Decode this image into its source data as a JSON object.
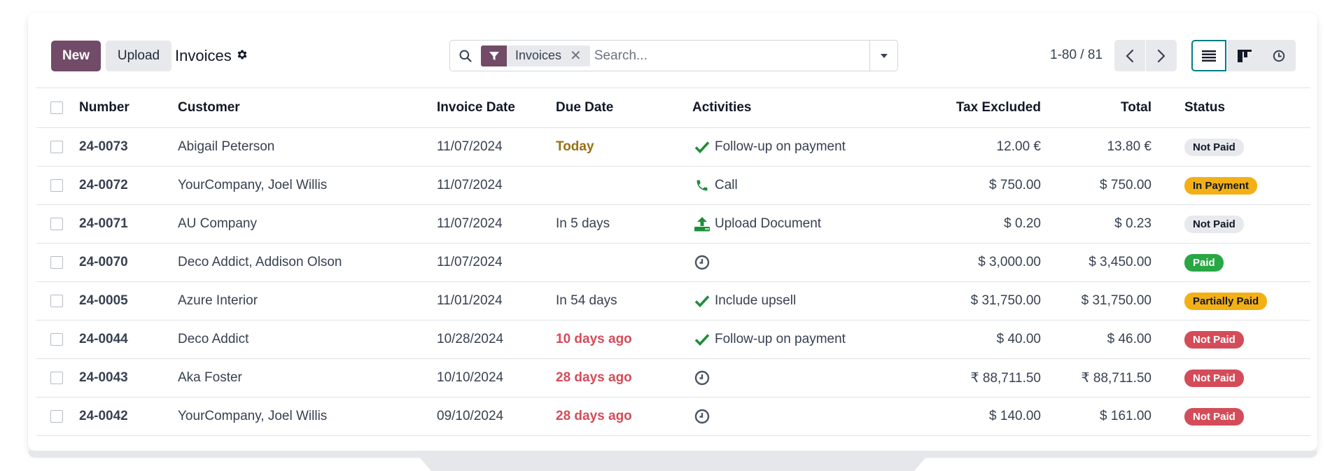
{
  "toolbar": {
    "new_label": "New",
    "upload_label": "Upload",
    "title": "Invoices"
  },
  "search": {
    "facet_label": "Invoices",
    "placeholder": "Search..."
  },
  "pager": {
    "value": "1-80 / 81"
  },
  "table": {
    "headers": {
      "number": "Number",
      "customer": "Customer",
      "invoice_date": "Invoice Date",
      "due_date": "Due Date",
      "activities": "Activities",
      "tax_excluded": "Tax Excluded",
      "total": "Total",
      "status": "Status"
    },
    "rows": [
      {
        "number": "24-0073",
        "customer": "Abigail Peterson",
        "invoice_date": "11/07/2024",
        "due_date": "Today",
        "activity_icon": "check-icon",
        "activity": "Follow-up on payment",
        "tax_excluded": "12.00 €",
        "total": "13.80 €",
        "status": "Not Paid"
      },
      {
        "number": "24-0072",
        "customer": "YourCompany, Joel Willis",
        "invoice_date": "11/07/2024",
        "due_date": "",
        "activity_icon": "phone-icon",
        "activity": "Call",
        "tax_excluded": "$ 750.00",
        "total": "$ 750.00",
        "status": "In Payment"
      },
      {
        "number": "24-0071",
        "customer": "AU Company",
        "invoice_date": "11/07/2024",
        "due_date": "In 5 days",
        "activity_icon": "upload-icon",
        "activity": "Upload Document",
        "tax_excluded": "$ 0.20",
        "total": "$ 0.23",
        "status": "Not Paid"
      },
      {
        "number": "24-0070",
        "customer": "Deco Addict, Addison Olson",
        "invoice_date": "11/07/2024",
        "due_date": "",
        "activity_icon": "clock-icon",
        "activity": "",
        "tax_excluded": "$ 3,000.00",
        "total": "$ 3,450.00",
        "status": "Paid"
      },
      {
        "number": "24-0005",
        "customer": "Azure Interior",
        "invoice_date": "11/01/2024",
        "due_date": "In 54 days",
        "activity_icon": "check-icon",
        "activity": "Include upsell",
        "tax_excluded": "$ 31,750.00",
        "total": "$ 31,750.00",
        "status": "Partially Paid"
      },
      {
        "number": "24-0044",
        "customer": "Deco Addict",
        "invoice_date": "10/28/2024",
        "due_date": "10 days ago",
        "activity_icon": "check-icon",
        "activity": "Follow-up on payment",
        "tax_excluded": "$ 40.00",
        "total": "$ 46.00",
        "status": "Not Paid"
      },
      {
        "number": "24-0043",
        "customer": "Aka Foster",
        "invoice_date": "10/10/2024",
        "due_date": "28 days ago",
        "activity_icon": "clock-icon",
        "activity": "",
        "tax_excluded": "₹ 88,711.50",
        "total": "₹ 88,711.50",
        "status": "Not Paid"
      },
      {
        "number": "24-0042",
        "customer": "YourCompany, Joel Willis",
        "invoice_date": "09/10/2024",
        "due_date": "28 days ago",
        "activity_icon": "clock-icon",
        "activity": "",
        "tax_excluded": "$ 140.00",
        "total": "$ 161.00",
        "status": "Not Paid"
      }
    ]
  },
  "colors": {
    "brand": "#714b67",
    "accent": "#017e84",
    "success": "#28a745",
    "warning": "#f3b016",
    "danger": "#d44c59",
    "today": "#987013"
  }
}
